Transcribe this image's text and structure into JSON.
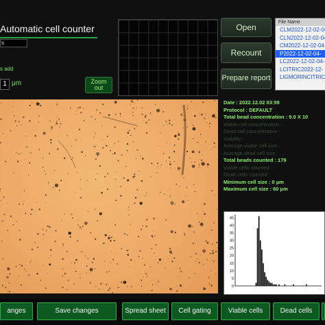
{
  "header": {
    "title": "Automatic cell counter",
    "small_field_value": "s",
    "cells_add_label": "s add",
    "size_value": "1",
    "size_unit": "μm",
    "zoom_out_label": "Zoom out"
  },
  "actions": {
    "open_label": "Open",
    "recount_label": "Recount",
    "prepare_report_label": "Prepare report"
  },
  "file_list": {
    "header": "File Name",
    "items": [
      "CLM2022-12-02-04-",
      "CLN2022-12-02-04-",
      "CM2022-12-02-04-",
      "P2022-12-02-04-",
      "LC2022-12-02-04-",
      "LCITRIC2022-12-",
      "LIGMORINCITRIC"
    ],
    "selected_index": 3
  },
  "results": {
    "date": "Date : 2022.12.02 03:59",
    "protocol": "Protocol : DEFAULT",
    "total_bead_conc": "Total bead concentration : 9.0 X 10",
    "viable_conc": "Viable cell concentration :",
    "dead_conc": "Dead cell concentration :",
    "viability": "Viability :",
    "avg_viable_size": "Average viable cell size :",
    "avg_dead_size": "Average dead cell size :",
    "total_beads": "Total beads counted : 179",
    "viable_counted": "Viable cells counted :",
    "dead_counted": "Dead cells counted :",
    "min_size": "Minimum cell size : 0 μm",
    "max_size": "Maximum cell size : 60 μm"
  },
  "histogram": {
    "y_ticks": [
      "0",
      "5",
      "10",
      "15",
      "20",
      "25",
      "30",
      "35",
      "40",
      "45"
    ],
    "y_max": 47,
    "bins": [
      0,
      0,
      0,
      0,
      0,
      0,
      0,
      0,
      0,
      0,
      0,
      0,
      0,
      0,
      2,
      38,
      46,
      30,
      24,
      15,
      9,
      6,
      4,
      3,
      2,
      2,
      1,
      1,
      1,
      0,
      1,
      0,
      0,
      0,
      1,
      0,
      0,
      0,
      0,
      0,
      1,
      0,
      0,
      0,
      0,
      0,
      0,
      0,
      0,
      1,
      0,
      0,
      0,
      0,
      0,
      0,
      0,
      0,
      0,
      0
    ]
  },
  "bottom_buttons": {
    "changes_label": "anges",
    "save_changes_label": "Save changes",
    "spread_sheet_label": "Spread sheet",
    "cell_gating_label": "Cell gating",
    "viable_cells_label": "Viable cells",
    "dead_cells_label": "Dead cells"
  }
}
